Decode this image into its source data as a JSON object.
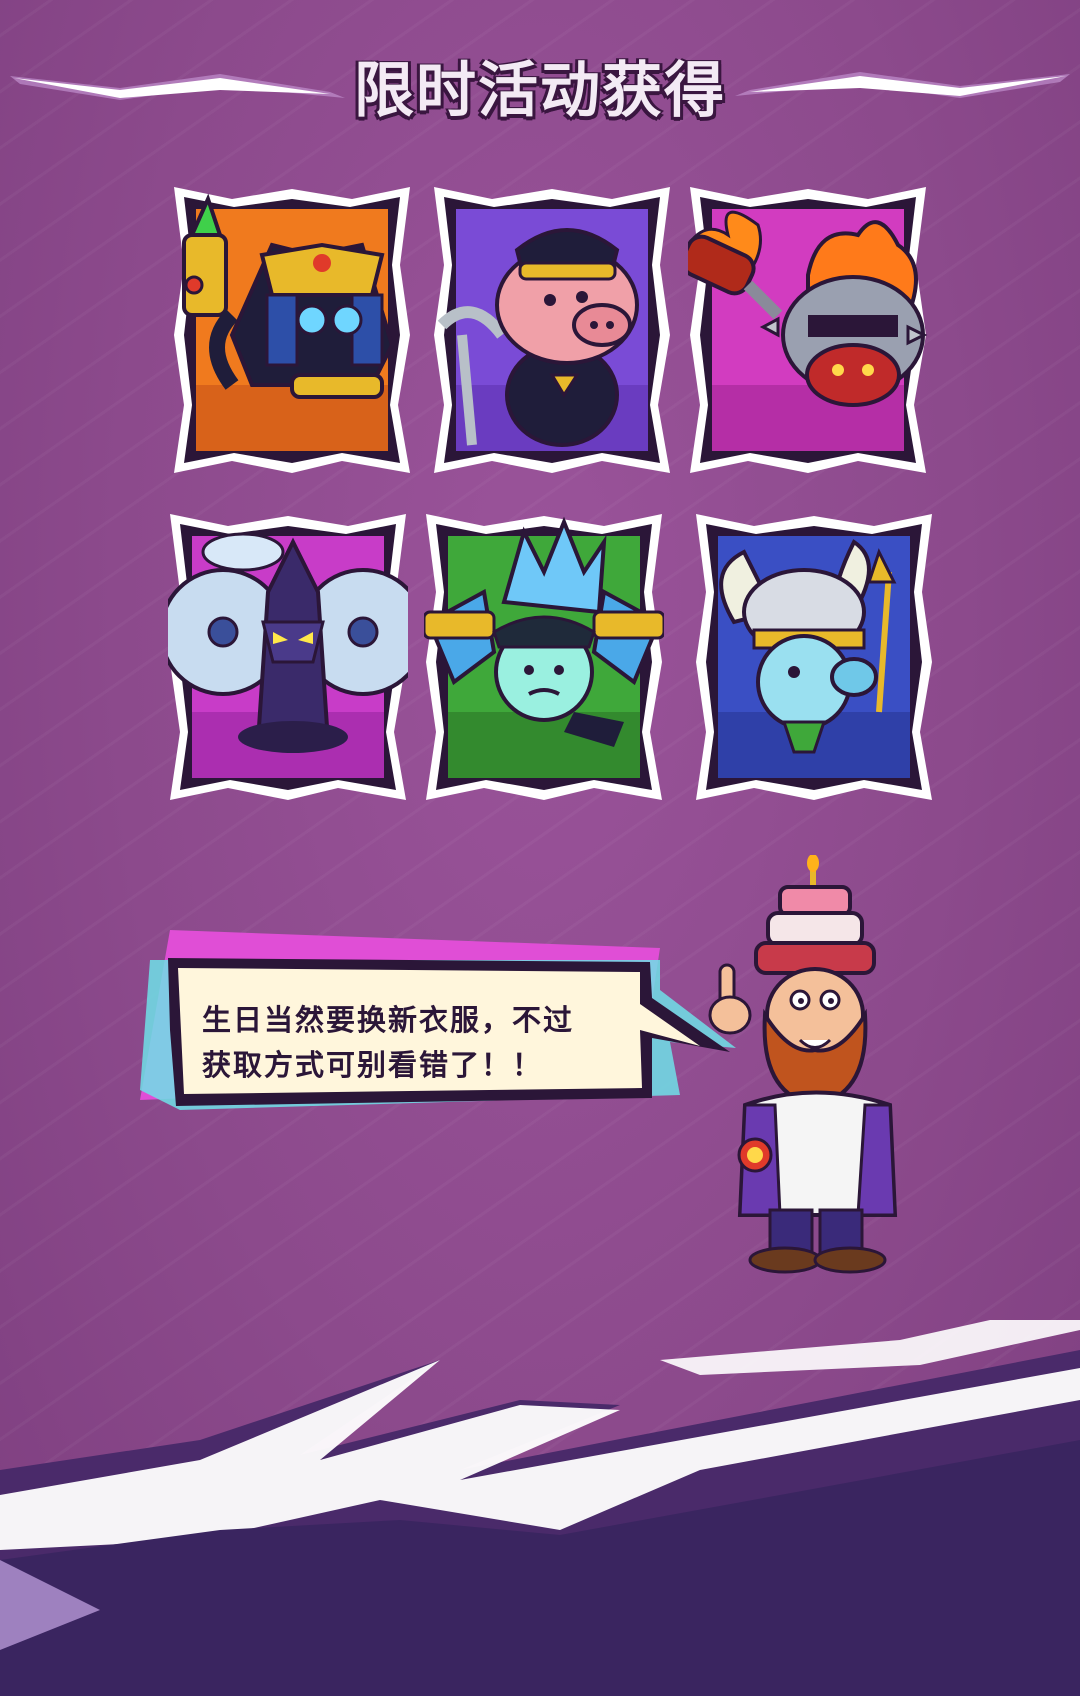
{
  "header": {
    "title": "限时活动获得"
  },
  "cards": [
    {
      "name": "pharaoh-cat-card",
      "bg": "#f07a1e"
    },
    {
      "name": "pig-reaper-card",
      "bg": "#7a4bd6"
    },
    {
      "name": "flame-knight-card",
      "bg": "#d23cc0"
    },
    {
      "name": "fan-ninja-card",
      "bg": "#c83cc8"
    },
    {
      "name": "ice-claw-card",
      "bg": "#3fa83a"
    },
    {
      "name": "valkyrie-pea-card",
      "bg": "#3a4fc4"
    }
  ],
  "speech": {
    "line1": "生日当然要换新衣服，不过",
    "line2": "获取方式可别看错了！！"
  },
  "colors": {
    "background": "#8c4a8c",
    "outline": "#2b1638",
    "bolt": "#ffffff",
    "bubble": "#fff6dc"
  }
}
